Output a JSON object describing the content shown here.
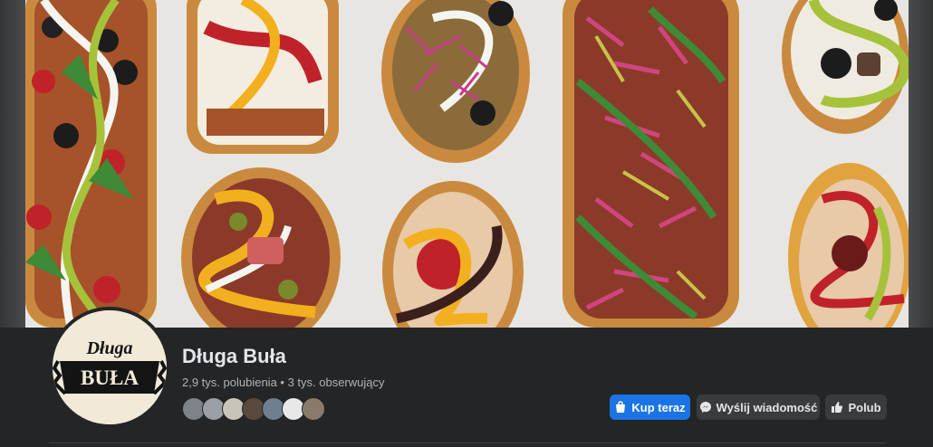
{
  "page": {
    "name": "Długa Buła",
    "stats": "2,9 tys. polubienia • 3 tys. obserwujący",
    "logo_top": "Długa",
    "logo_bottom": "BUŁA"
  },
  "friends": [
    "friend-1",
    "friend-2",
    "friend-3",
    "friend-4",
    "friend-5",
    "friend-6",
    "friend-7"
  ],
  "actions": {
    "buy_label": "Kup teraz",
    "buy_icon": "shopping-bag-icon",
    "message_label": "Wyślij wiadomość",
    "message_icon": "messenger-icon",
    "like_label": "Polub",
    "like_icon": "thumbs-up-icon"
  },
  "colors": {
    "background": "#18191a",
    "surface": "#242526",
    "primary_button": "#1b74e4",
    "secondary_button": "#3a3b3c",
    "text_primary": "#e4e6eb",
    "text_secondary": "#b0b3b8"
  }
}
